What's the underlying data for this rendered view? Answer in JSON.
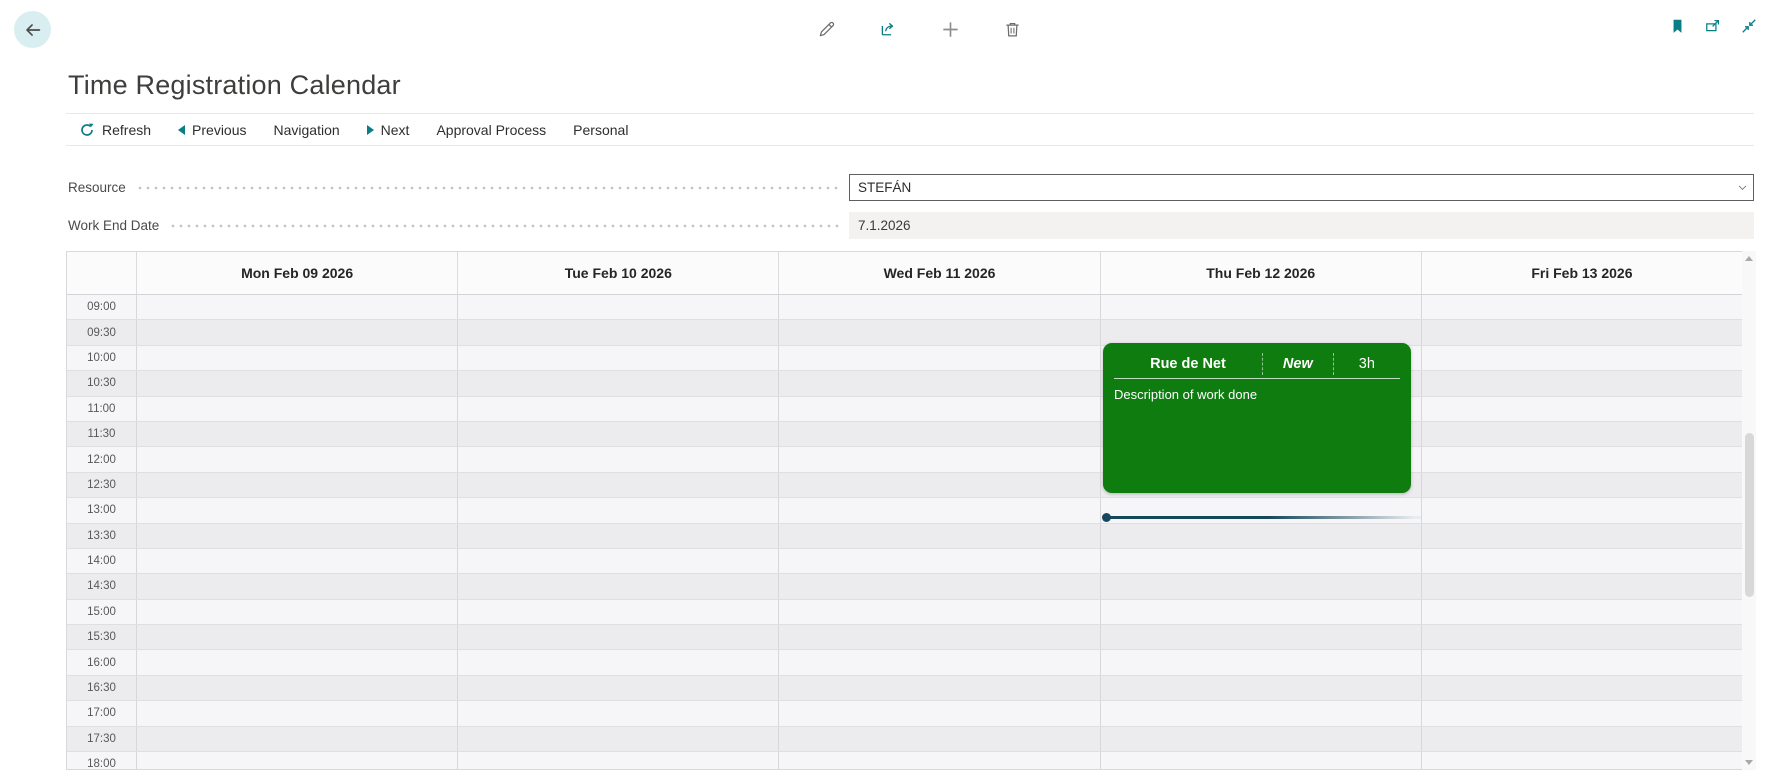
{
  "page": {
    "title": "Time Registration Calendar"
  },
  "toolbar": {
    "back": "back",
    "edit": "edit",
    "share": "share",
    "add": "add",
    "delete": "delete",
    "bookmark": "bookmark",
    "open_in_new_window": "open in new window",
    "collapse": "collapse"
  },
  "actionbar": {
    "items": [
      {
        "label": "Refresh",
        "icon": "refresh-icon"
      },
      {
        "label": "Previous",
        "icon": "triangle-left-icon"
      },
      {
        "label": "Navigation",
        "icon": ""
      },
      {
        "label": "Next",
        "icon": "triangle-right-icon"
      },
      {
        "label": "Approval Process",
        "icon": ""
      },
      {
        "label": "Personal",
        "icon": ""
      }
    ]
  },
  "fields": {
    "resource": {
      "label": "Resource",
      "value": "STEFÁN"
    },
    "work_end_date": {
      "label": "Work End Date",
      "value": "7.1.2026"
    }
  },
  "calendar": {
    "day_headers": [
      "Mon Feb 09 2026",
      "Tue Feb 10 2026",
      "Wed Feb 11 2026",
      "Thu Feb 12 2026",
      "Fri Feb 13 2026"
    ],
    "time_slots": [
      "09:00",
      "09:30",
      "10:00",
      "10:30",
      "11:00",
      "11:30",
      "12:00",
      "12:30",
      "13:00",
      "13:30",
      "14:00",
      "14:30",
      "15:00",
      "15:30",
      "16:00",
      "16:30",
      "17:00",
      "17:30",
      "18:00"
    ],
    "event": {
      "customer": "Rue de Net",
      "status": "New",
      "duration": "3h",
      "description": "Description of work done",
      "day": "Thu Feb 12 2026",
      "start_time": "10:00",
      "end_time": "13:00"
    },
    "indicator": {
      "day": "Thu Feb 12 2026"
    }
  },
  "colors": {
    "accent_teal": "#0a7e87",
    "event_green": "#0e7c0f",
    "indicator_dark": "#17475c",
    "readonly_field_bg": "#f3f2f1",
    "row_light": "#f6f6f8",
    "row_dark": "#ececef"
  }
}
